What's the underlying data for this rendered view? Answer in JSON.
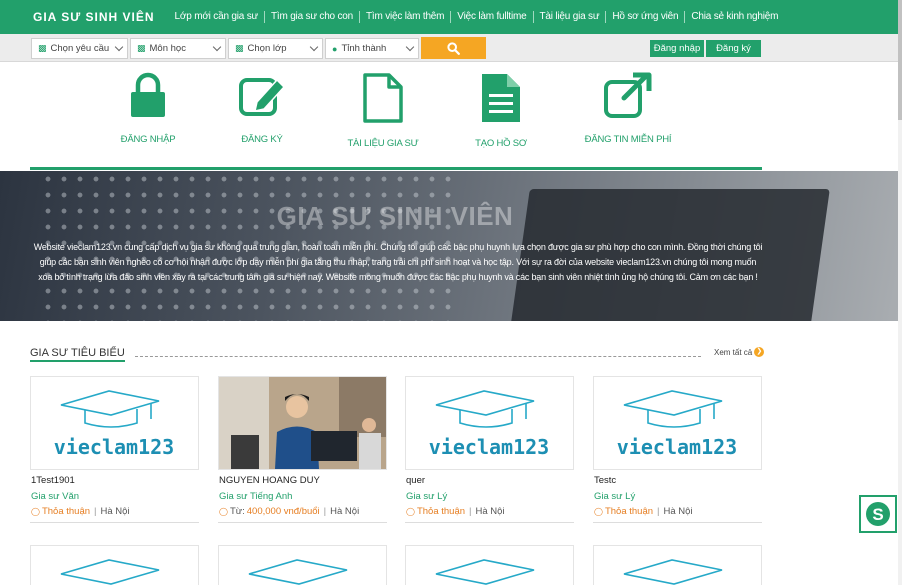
{
  "header": {
    "logo": "GIA SƯ SINH VIÊN",
    "nav": [
      "Lớp mới cần gia sư",
      "Tìm gia sư cho con",
      "Tìm việc làm thêm",
      "Việc làm fulltime",
      "Tài liệu gia sư",
      "Hồ sơ ứng viên",
      "Chia sẻ kinh nghiệm"
    ]
  },
  "filters": {
    "request": "Chọn yêu cầu",
    "subject": "Môn học",
    "grade": "Chọn lớp",
    "city": "Tỉnh thành",
    "search_icon": "search-icon"
  },
  "auth": {
    "login": "Đăng nhập",
    "register": "Đăng ký"
  },
  "features": [
    {
      "icon": "lock-icon",
      "label": "ĐĂNG NHẬP"
    },
    {
      "icon": "edit-icon",
      "label": "ĐĂNG KÝ"
    },
    {
      "icon": "document-icon",
      "label": "TÀI LIỆU GIA SƯ"
    },
    {
      "icon": "file-text-icon",
      "label": "TẠO HỒ SƠ"
    },
    {
      "icon": "external-link-icon",
      "label": "ĐĂNG TIN MIỄN PHÍ"
    }
  ],
  "banner": {
    "title": "GIA SƯ SINH VIÊN",
    "text": "Website vieclam123.vn cung cấp dịch vụ gia sư không qua trung gian, hoàn toàn miễn phí. Chúng tôi giúp các bậc phụ huynh lựa chọn được gia sư phù hợp cho con mình. Đồng thời chúng tôi giúp các bạn sinh viên nghèo có cơ hội nhận được lớp dạy miễn phí gia tăng thu nhập, trang trải chi phí sinh hoạt và học tập. Với sự ra đời của website vieclam123.vn chúng tôi mong muốn xóa bỏ tình trạng lừa đảo sinh viên xảy ra tại các trung tâm gia sư hiện nay. Website mong muốn được các bậc phụ huynh và các bạn sinh viên nhiệt tình ủng hộ chúng tôi. Cảm ơn các bạn !"
  },
  "section": {
    "title": "GIA SƯ TIÊU BIỂU",
    "view_all": "Xem tất cả"
  },
  "tutors": [
    {
      "name": "1Test1901",
      "subject": "Gia sư Văn",
      "price": "Thỏa thuận",
      "location": "Hà Nội",
      "thumb": "vieclam123"
    },
    {
      "name": "NGUYEN HOANG DUY",
      "subject": "Gia sư Tiếng Anh",
      "price_prefix": "Từ:",
      "price": "400,000 vnđ/buổi",
      "location": "Hà Nội",
      "thumb": "photo"
    },
    {
      "name": "quer",
      "subject": "Gia sư Lý",
      "price": "Thỏa thuận",
      "location": "Hà Nội",
      "thumb": "vieclam123"
    },
    {
      "name": "Testc",
      "subject": "Gia sư Lý",
      "price": "Thỏa thuận",
      "location": "Hà Nội",
      "thumb": "vieclam123"
    }
  ],
  "brand_text": "vieclam123",
  "colors": {
    "primary": "#22a06b",
    "accent": "#f5a623",
    "price": "#e67e22"
  }
}
